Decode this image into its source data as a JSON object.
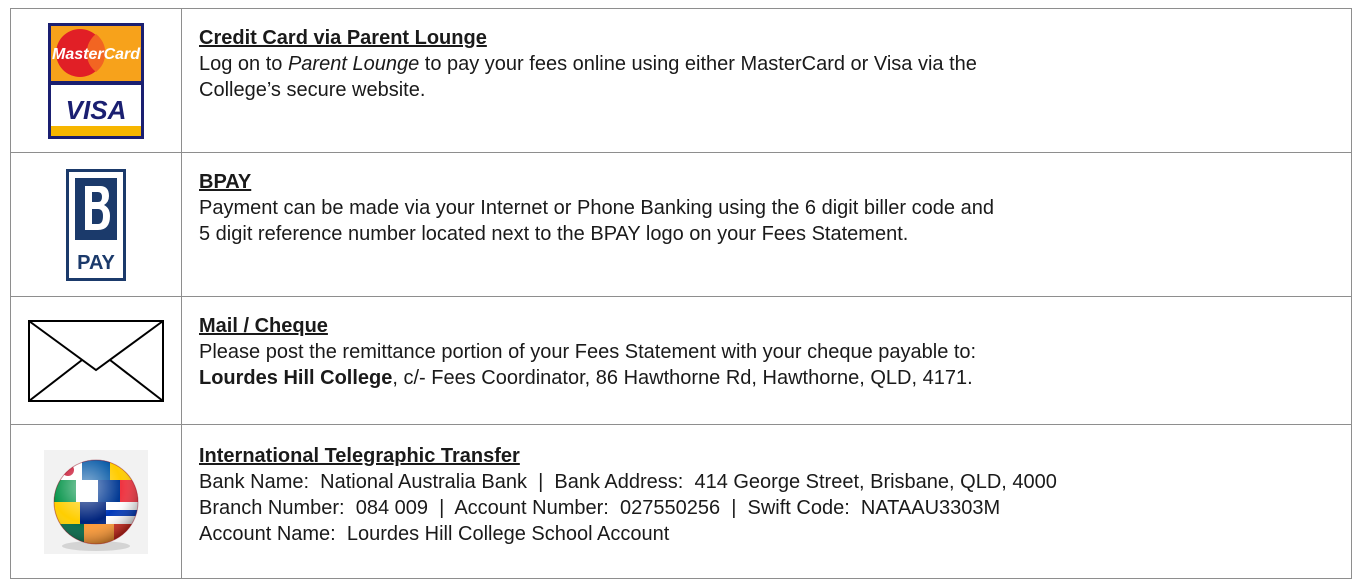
{
  "rows": [
    {
      "icon": "mastercard-visa-icon",
      "logo": {
        "top": "MasterCard",
        "bottom": "VISA"
      },
      "heading": "Credit Card via Parent Lounge",
      "line1_a": "Log on to ",
      "line1_em": "Parent Lounge",
      "line1_b": " to pay your fees online using either MasterCard or Visa via the",
      "line2": "College’s secure website."
    },
    {
      "icon": "bpay-icon",
      "logo": {
        "text": "PAY"
      },
      "heading": "BPAY",
      "line1": "Payment can be made via your Internet or Phone Banking using the 6 digit biller code and",
      "line2": "5 digit reference number located next to the BPAY logo on your Fees Statement."
    },
    {
      "icon": "envelope-icon",
      "heading": "Mail / Cheque",
      "line1": "Please post the remittance portion of your Fees Statement with your cheque payable to:",
      "line2_bold": "Lourdes Hill College",
      "line2_rest": ", c/- Fees Coordinator, 86 Hawthorne Rd, Hawthorne, QLD, 4171."
    },
    {
      "icon": "globe-flags-icon",
      "heading": "International Telegraphic Transfer",
      "line1": "Bank Name:  National Australia Bank  |  Bank Address:  414 George Street, Brisbane, QLD, 4000",
      "line2": "Branch Number:  084 009  |  Account Number:  027550256  |  Swift Code:  NATAAU3303M",
      "line3": "Account Name:  Lourdes Hill College School Account"
    }
  ],
  "colors": {
    "border": "#8e8e8e",
    "mastercard_red": "#e11f26",
    "mastercard_orange": "#f7a21b",
    "visa_blue": "#1a1f71",
    "visa_gold": "#f7b600",
    "bpay_blue": "#1b3a6b"
  }
}
